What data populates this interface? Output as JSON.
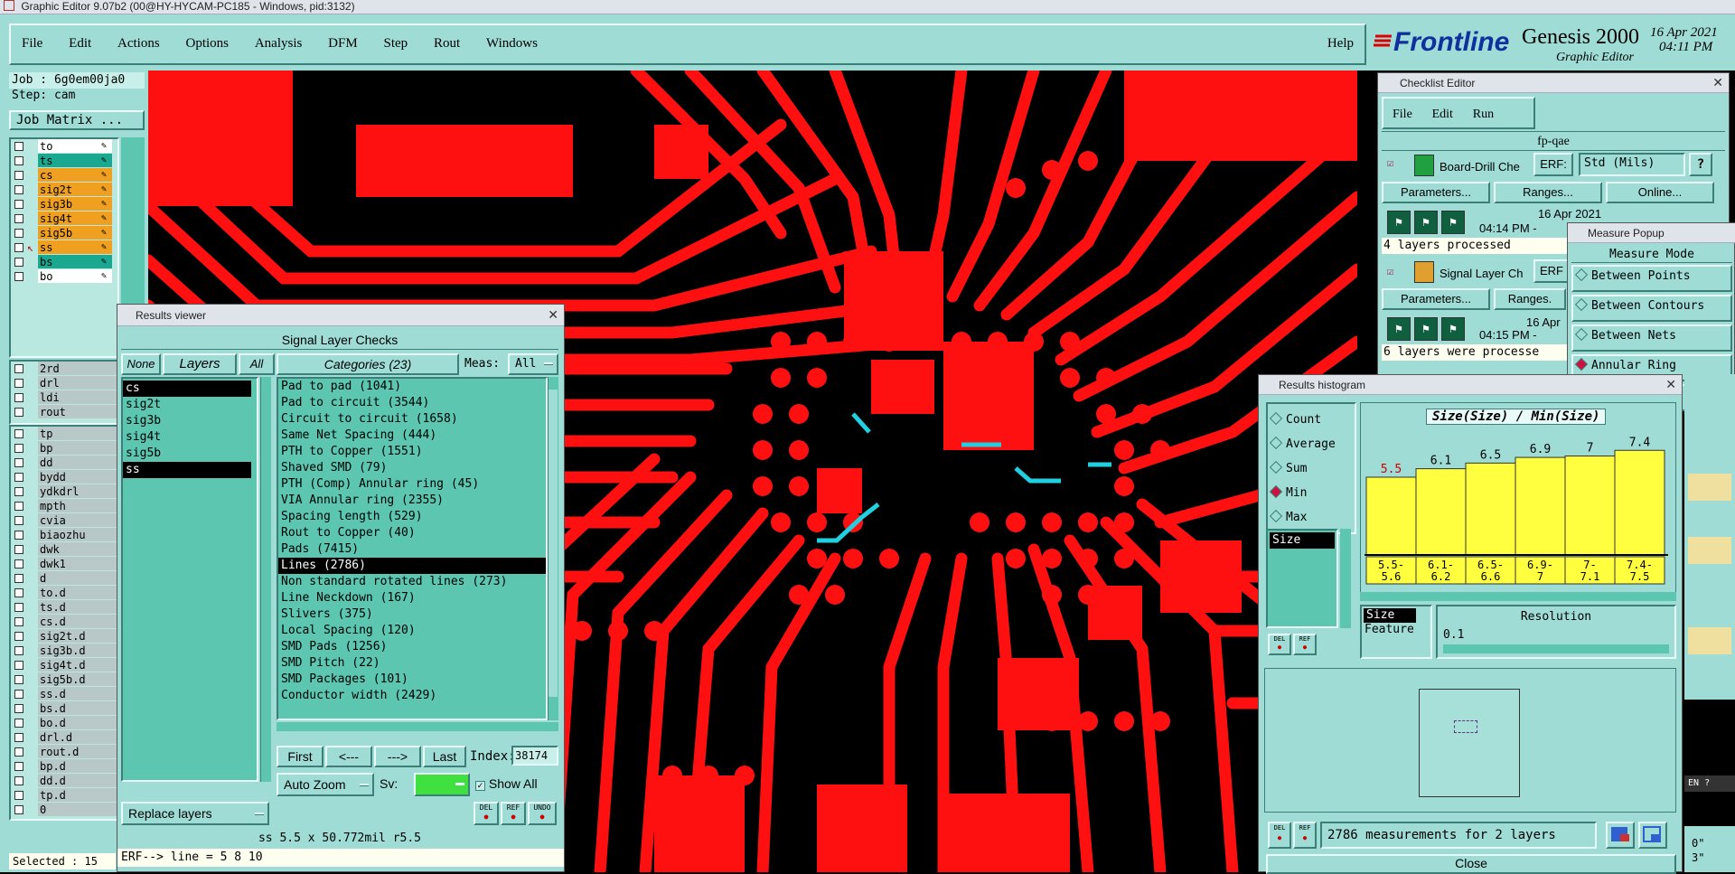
{
  "window_title": "Graphic Editor 9.07b2 (00@HY-HYCAM-PC185 - Windows, pid:3132)",
  "menu": [
    "File",
    "Edit",
    "Actions",
    "Options",
    "Analysis",
    "DFM",
    "Step",
    "Rout",
    "Windows"
  ],
  "help_label": "Help",
  "brand": {
    "logo": "Frontline",
    "product": "Genesis 2000",
    "subtitle": "Graphic Editor",
    "date": "16 Apr 2021",
    "time": "04:11 PM"
  },
  "left_panel": {
    "job": "Job : 6g0em00ja0",
    "step": "Step: cam",
    "job_matrix": "Job Matrix ...",
    "board_layers": [
      {
        "name": "to",
        "color": "#ffffff"
      },
      {
        "name": "ts",
        "color": "#1aa890"
      },
      {
        "name": "cs",
        "color": "#f0a020"
      },
      {
        "name": "sig2t",
        "color": "#f0a020"
      },
      {
        "name": "sig3b",
        "color": "#f0a020"
      },
      {
        "name": "sig4t",
        "color": "#f0a020"
      },
      {
        "name": "sig5b",
        "color": "#f0a020"
      },
      {
        "name": "ss",
        "color": "#f0a020"
      },
      {
        "name": "bs",
        "color": "#1aa890"
      },
      {
        "name": "bo",
        "color": "#ffffff"
      }
    ],
    "drill_layers": [
      "2rd",
      "drl",
      "ldi",
      "rout"
    ],
    "misc_layers": [
      "tp",
      "bp",
      "dd",
      "bydd",
      "ydkdrl",
      "mpth",
      "cvia",
      "biaozhu",
      "dwk",
      "dwk1",
      "d",
      "to.d",
      "ts.d",
      "cs.d",
      "sig2t.d",
      "sig3b.d",
      "sig4t.d",
      "sig5b.d",
      "ss.d",
      "bs.d",
      "bo.d",
      "drl.d",
      "rout.d",
      "bp.d",
      "dd.d",
      "tp.d",
      "0"
    ],
    "selected": "Selected : 15"
  },
  "results_viewer": {
    "title": "Results viewer",
    "header": "Signal Layer Checks",
    "btn_none": "None",
    "btn_layers": "Layers",
    "btn_all": "All",
    "btn_categories": "Categories (23)",
    "meas_label": "Meas:",
    "meas_value": "All",
    "layers": [
      "cs",
      "sig2t",
      "sig3b",
      "sig4t",
      "sig5b",
      "ss"
    ],
    "categories": [
      "Pad to pad (1041)",
      "Pad to circuit (3544)",
      "Circuit to circuit (1658)",
      "Same Net Spacing (444)",
      "PTH to Copper (1551)",
      "Shaved SMD (79)",
      "PTH (Comp) Annular ring (45)",
      "VIA Annular ring (2355)",
      "Spacing length (529)",
      "Rout to Copper (40)",
      "Pads (7415)",
      "Lines (2786)",
      "Non standard rotated lines (273)",
      "Line Neckdown (167)",
      "Slivers (375)",
      "Local Spacing (120)",
      "SMD Pads (1256)",
      "SMD Pitch (22)",
      "SMD Packages (101)",
      "Conductor width (2429)"
    ],
    "nav": {
      "first": "First",
      "prev": "<---",
      "next": "--->",
      "last": "Last",
      "index_label": "Index:",
      "index_value": "38174"
    },
    "auto_zoom": "Auto Zoom",
    "sv_label": "Sv:",
    "show_all": "Show All",
    "replace_layers": "Replace layers",
    "icons": [
      "DEL",
      "REF",
      "UNDO"
    ],
    "status": "ss 5.5 x 50.772mil  r5.5",
    "erf": "ERF--> line = 5 8 10"
  },
  "checklist_editor": {
    "title": "Checklist Editor",
    "menu": [
      "File",
      "Edit",
      "Run"
    ],
    "name": "fp-qae",
    "check1": {
      "name": "Board-Drill Che",
      "erf_label": "ERF:",
      "erf_value": "Std (Mils)",
      "params": "Parameters...",
      "ranges": "Ranges...",
      "online": "Online...",
      "date": "16 Apr 2021",
      "time": "04:14 PM -",
      "status": "4 layers processed"
    },
    "check2": {
      "name": "Signal Layer Ch",
      "erf_label": "ERF",
      "params": "Parameters...",
      "ranges": "Ranges.",
      "date": "16 Apr",
      "time": "04:15 PM -",
      "status": "6 layers were processe"
    }
  },
  "measure_popup": {
    "title": "Measure Popup",
    "header": "Measure Mode",
    "options": [
      "Between Points",
      "Between Contours",
      "Between Nets",
      "Annular Ring",
      "oints"
    ],
    "selected": "Annular Ring"
  },
  "histogram": {
    "title": "Results histogram",
    "stats": [
      "Count",
      "Average",
      "Sum",
      "Min",
      "Max"
    ],
    "selected_stat": "Min",
    "list_items": [
      "Size"
    ],
    "chart_title": "Size(Size) / Min(Size)",
    "size_list": [
      "Size",
      "Feature"
    ],
    "resolution_label": "Resolution",
    "resolution_value": "0.1",
    "footer_text": "2786 measurements for 2 layers",
    "icons": [
      "DEL",
      "REF"
    ],
    "close_label": "Close"
  },
  "chart_data": {
    "type": "bar",
    "title": "Size(Size) / Min(Size)",
    "categories": [
      "5.5-5.6",
      "6.1-6.2",
      "6.5-6.6",
      "6.9-7",
      "7-7.1",
      "7.4-7.5"
    ],
    "category_labels_top": [
      "5.5-",
      "6.1-",
      "6.5-",
      "6.9-",
      "7-",
      "7.4-"
    ],
    "category_labels_bottom": [
      "5.6",
      "6.2",
      "6.6",
      "7",
      "7.1",
      "7.5"
    ],
    "values": [
      5.5,
      6.1,
      6.5,
      6.9,
      7,
      7.4
    ],
    "ylim": [
      0,
      7.8
    ],
    "colors": {
      "bar": "#ffff40",
      "highlight_label": "#d00000"
    }
  },
  "tray": {
    "lang": "EN"
  },
  "right_edge": {
    "a": "0\"",
    "b": "3\""
  }
}
